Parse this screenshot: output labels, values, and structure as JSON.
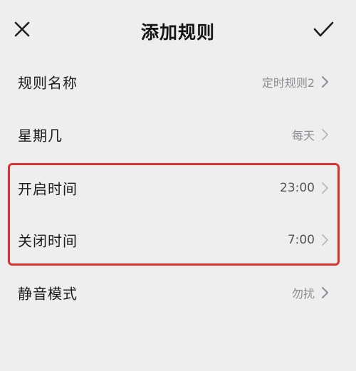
{
  "header": {
    "title": "添加规则"
  },
  "rows": [
    {
      "label": "规则名称",
      "value": "定时规则2"
    },
    {
      "label": "星期几",
      "value": "每天"
    },
    {
      "label": "开启时间",
      "value": "23:00"
    },
    {
      "label": "关闭时间",
      "value": "7:00"
    },
    {
      "label": "静音模式",
      "value": "勿扰"
    }
  ],
  "colors": {
    "background": "#eeeeee",
    "text": "#1c1c1c",
    "value_text": "#8d8d95",
    "chevron": "#9a9aa8",
    "highlight": "#d9322f"
  },
  "icons": {
    "close": "close-icon",
    "confirm": "checkmark-icon",
    "chevron": "chevron-right-icon"
  }
}
